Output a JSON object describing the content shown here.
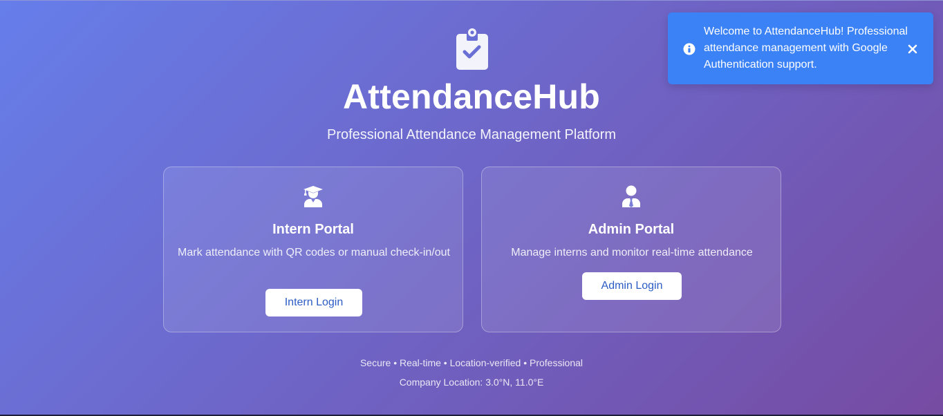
{
  "app": {
    "title": "AttendanceHub",
    "subtitle": "Professional Attendance Management Platform",
    "logo_icon": "clipboard-check-icon"
  },
  "cards": {
    "intern": {
      "icon": "graduate-user-icon",
      "title": "Intern Portal",
      "description": "Mark attendance with QR codes or manual check-in/out",
      "button_label": "Intern Login"
    },
    "admin": {
      "icon": "user-tie-icon",
      "title": "Admin Portal",
      "description": "Manage interns and monitor real-time attendance",
      "button_label": "Admin Login"
    }
  },
  "footer": {
    "features": "Secure • Real-time • Location-verified • Professional",
    "location": "Company Location: 3.0°N, 11.0°E"
  },
  "toast": {
    "message": "Welcome to AttendanceHub! Professional attendance management with Google Authentication support.",
    "icon": "info-circle-icon",
    "close_icon": "close-icon",
    "background_color": "#3b82f6"
  },
  "colors": {
    "gradient_start": "#667eea",
    "gradient_end": "#764ba2",
    "button_text": "#2b5cc4"
  }
}
